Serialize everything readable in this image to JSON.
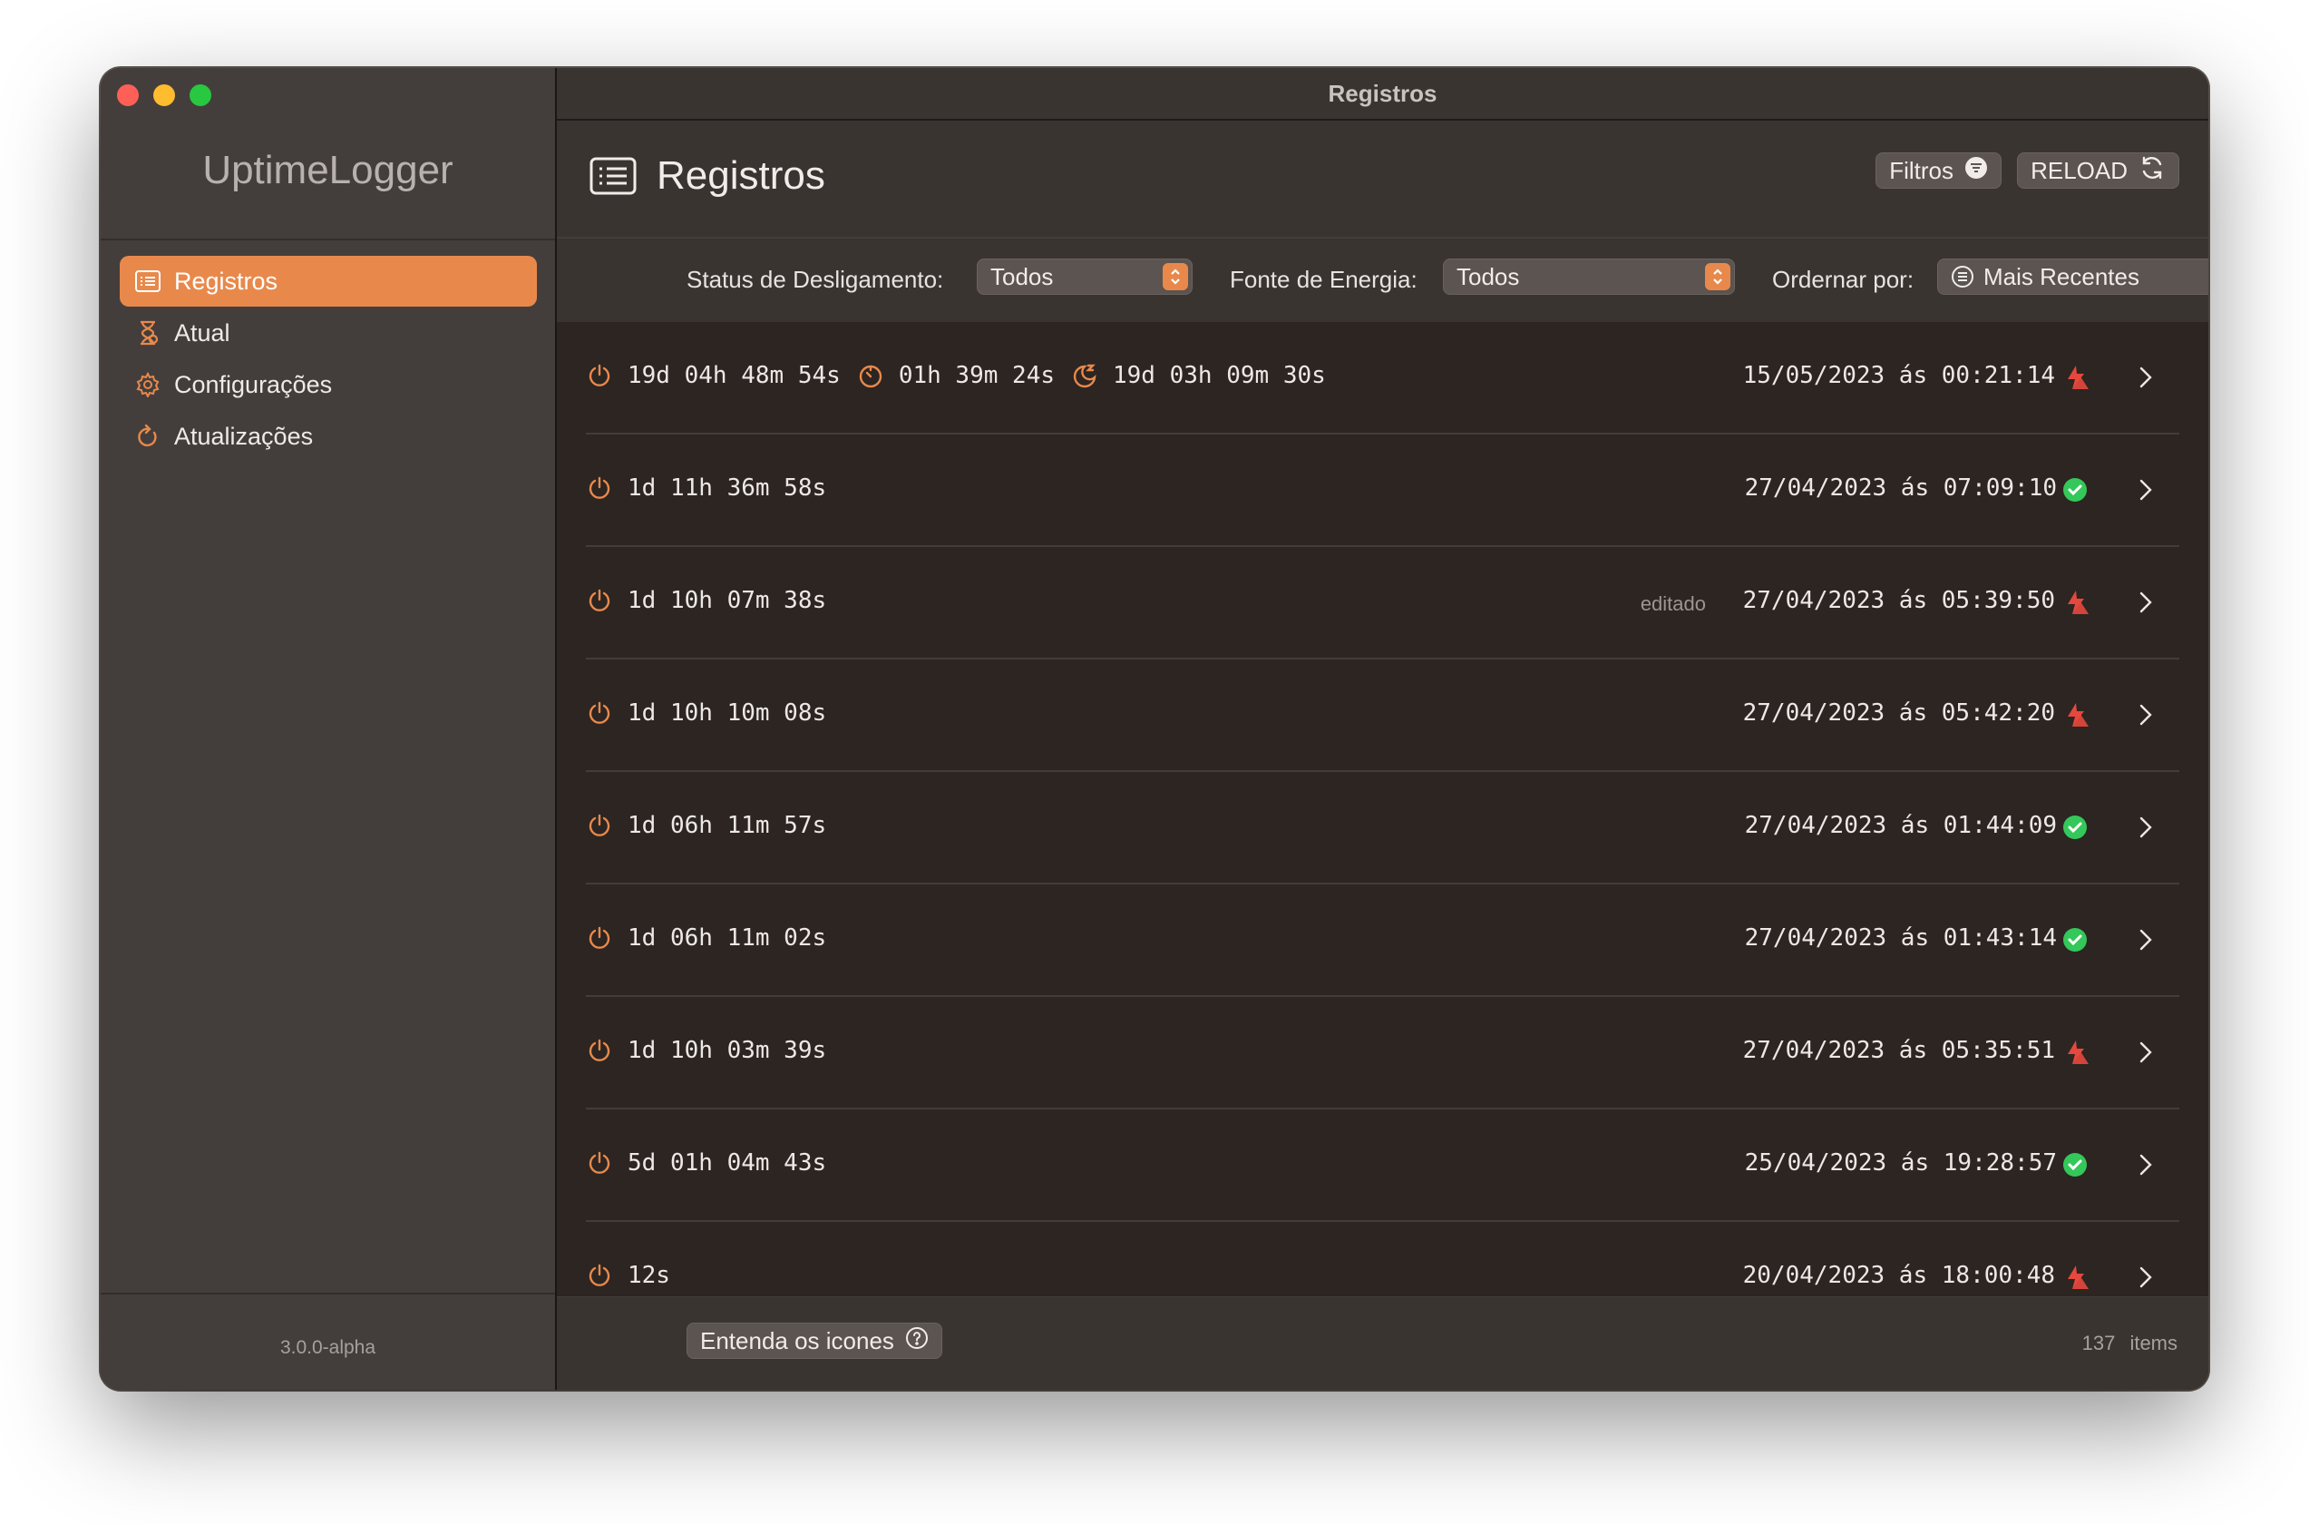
{
  "window": {
    "title": "Registros"
  },
  "sidebar": {
    "app_name": "UptimeLogger",
    "items": [
      {
        "label": "Registros",
        "icon": "list-icon",
        "active": true
      },
      {
        "label": "Atual",
        "icon": "hourglass-icon",
        "active": false
      },
      {
        "label": "Configurações",
        "icon": "gear-icon",
        "active": false
      },
      {
        "label": "Atualizações",
        "icon": "refresh-icon",
        "active": false
      }
    ],
    "version": "3.0.0-alpha"
  },
  "header": {
    "title": "Registros",
    "filters_label": "Filtros",
    "reload_label": "RELOAD"
  },
  "filters": {
    "shutdown_status_label": "Status de Desligamento:",
    "shutdown_status_value": "Todos",
    "power_source_label": "Fonte de Energia:",
    "power_source_value": "Todos",
    "sort_label": "Ordernar por:",
    "sort_value": "Mais Recentes"
  },
  "records": [
    {
      "uptime": "19d 04h 48m 54s",
      "active_time": "01h 39m 24s",
      "sleep_time": "19d 03h 09m 30s",
      "edited": "",
      "date": "15/05/2023 ás 00:21:14",
      "status": "abrupt"
    },
    {
      "uptime": "1d 11h 36m 58s",
      "edited": "",
      "date": "27/04/2023 ás 07:09:10",
      "status": "normal"
    },
    {
      "uptime": "1d 10h 07m 38s",
      "edited": "editado",
      "date": "27/04/2023 ás 05:39:50",
      "status": "abrupt"
    },
    {
      "uptime": "1d 10h 10m 08s",
      "edited": "",
      "date": "27/04/2023 ás 05:42:20",
      "status": "abrupt"
    },
    {
      "uptime": "1d 06h 11m 57s",
      "edited": "",
      "date": "27/04/2023 ás 01:44:09",
      "status": "normal"
    },
    {
      "uptime": "1d 06h 11m 02s",
      "edited": "",
      "date": "27/04/2023 ás 01:43:14",
      "status": "normal"
    },
    {
      "uptime": "1d 10h 03m 39s",
      "edited": "",
      "date": "27/04/2023 ás 05:35:51",
      "status": "abrupt"
    },
    {
      "uptime": "5d 01h 04m 43s",
      "edited": "",
      "date": "25/04/2023 ás 19:28:57",
      "status": "normal"
    },
    {
      "uptime": "12s",
      "edited": "",
      "date": "20/04/2023 ás 18:00:48",
      "status": "abrupt"
    }
  ],
  "footer": {
    "legend_label": "Entenda os icones",
    "count": "137",
    "count_unit": "items"
  },
  "colors": {
    "accent": "#e8894b",
    "success": "#34c759",
    "danger": "#e5483d"
  }
}
